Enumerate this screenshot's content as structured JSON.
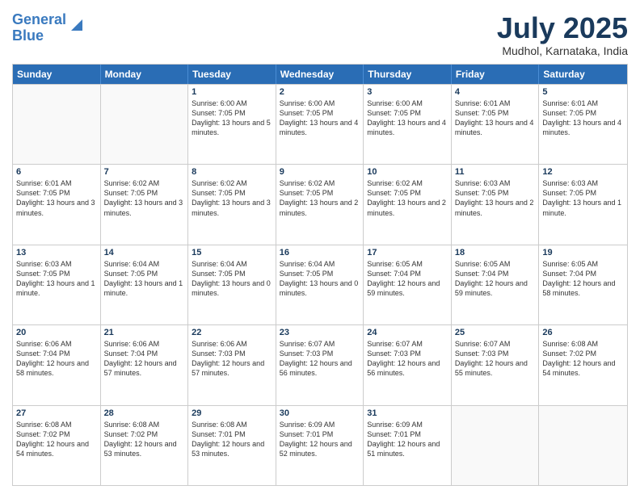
{
  "logo": {
    "line1": "General",
    "line2": "Blue"
  },
  "title": "July 2025",
  "location": "Mudhol, Karnataka, India",
  "days_of_week": [
    "Sunday",
    "Monday",
    "Tuesday",
    "Wednesday",
    "Thursday",
    "Friday",
    "Saturday"
  ],
  "weeks": [
    [
      {
        "day": "",
        "sunrise": "",
        "sunset": "",
        "daylight": "",
        "empty": true
      },
      {
        "day": "",
        "sunrise": "",
        "sunset": "",
        "daylight": "",
        "empty": true
      },
      {
        "day": "1",
        "sunrise": "Sunrise: 6:00 AM",
        "sunset": "Sunset: 7:05 PM",
        "daylight": "Daylight: 13 hours and 5 minutes."
      },
      {
        "day": "2",
        "sunrise": "Sunrise: 6:00 AM",
        "sunset": "Sunset: 7:05 PM",
        "daylight": "Daylight: 13 hours and 4 minutes."
      },
      {
        "day": "3",
        "sunrise": "Sunrise: 6:00 AM",
        "sunset": "Sunset: 7:05 PM",
        "daylight": "Daylight: 13 hours and 4 minutes."
      },
      {
        "day": "4",
        "sunrise": "Sunrise: 6:01 AM",
        "sunset": "Sunset: 7:05 PM",
        "daylight": "Daylight: 13 hours and 4 minutes."
      },
      {
        "day": "5",
        "sunrise": "Sunrise: 6:01 AM",
        "sunset": "Sunset: 7:05 PM",
        "daylight": "Daylight: 13 hours and 4 minutes."
      }
    ],
    [
      {
        "day": "6",
        "sunrise": "Sunrise: 6:01 AM",
        "sunset": "Sunset: 7:05 PM",
        "daylight": "Daylight: 13 hours and 3 minutes."
      },
      {
        "day": "7",
        "sunrise": "Sunrise: 6:02 AM",
        "sunset": "Sunset: 7:05 PM",
        "daylight": "Daylight: 13 hours and 3 minutes."
      },
      {
        "day": "8",
        "sunrise": "Sunrise: 6:02 AM",
        "sunset": "Sunset: 7:05 PM",
        "daylight": "Daylight: 13 hours and 3 minutes."
      },
      {
        "day": "9",
        "sunrise": "Sunrise: 6:02 AM",
        "sunset": "Sunset: 7:05 PM",
        "daylight": "Daylight: 13 hours and 2 minutes."
      },
      {
        "day": "10",
        "sunrise": "Sunrise: 6:02 AM",
        "sunset": "Sunset: 7:05 PM",
        "daylight": "Daylight: 13 hours and 2 minutes."
      },
      {
        "day": "11",
        "sunrise": "Sunrise: 6:03 AM",
        "sunset": "Sunset: 7:05 PM",
        "daylight": "Daylight: 13 hours and 2 minutes."
      },
      {
        "day": "12",
        "sunrise": "Sunrise: 6:03 AM",
        "sunset": "Sunset: 7:05 PM",
        "daylight": "Daylight: 13 hours and 1 minute."
      }
    ],
    [
      {
        "day": "13",
        "sunrise": "Sunrise: 6:03 AM",
        "sunset": "Sunset: 7:05 PM",
        "daylight": "Daylight: 13 hours and 1 minute."
      },
      {
        "day": "14",
        "sunrise": "Sunrise: 6:04 AM",
        "sunset": "Sunset: 7:05 PM",
        "daylight": "Daylight: 13 hours and 1 minute."
      },
      {
        "day": "15",
        "sunrise": "Sunrise: 6:04 AM",
        "sunset": "Sunset: 7:05 PM",
        "daylight": "Daylight: 13 hours and 0 minutes."
      },
      {
        "day": "16",
        "sunrise": "Sunrise: 6:04 AM",
        "sunset": "Sunset: 7:05 PM",
        "daylight": "Daylight: 13 hours and 0 minutes."
      },
      {
        "day": "17",
        "sunrise": "Sunrise: 6:05 AM",
        "sunset": "Sunset: 7:04 PM",
        "daylight": "Daylight: 12 hours and 59 minutes."
      },
      {
        "day": "18",
        "sunrise": "Sunrise: 6:05 AM",
        "sunset": "Sunset: 7:04 PM",
        "daylight": "Daylight: 12 hours and 59 minutes."
      },
      {
        "day": "19",
        "sunrise": "Sunrise: 6:05 AM",
        "sunset": "Sunset: 7:04 PM",
        "daylight": "Daylight: 12 hours and 58 minutes."
      }
    ],
    [
      {
        "day": "20",
        "sunrise": "Sunrise: 6:06 AM",
        "sunset": "Sunset: 7:04 PM",
        "daylight": "Daylight: 12 hours and 58 minutes."
      },
      {
        "day": "21",
        "sunrise": "Sunrise: 6:06 AM",
        "sunset": "Sunset: 7:04 PM",
        "daylight": "Daylight: 12 hours and 57 minutes."
      },
      {
        "day": "22",
        "sunrise": "Sunrise: 6:06 AM",
        "sunset": "Sunset: 7:03 PM",
        "daylight": "Daylight: 12 hours and 57 minutes."
      },
      {
        "day": "23",
        "sunrise": "Sunrise: 6:07 AM",
        "sunset": "Sunset: 7:03 PM",
        "daylight": "Daylight: 12 hours and 56 minutes."
      },
      {
        "day": "24",
        "sunrise": "Sunrise: 6:07 AM",
        "sunset": "Sunset: 7:03 PM",
        "daylight": "Daylight: 12 hours and 56 minutes."
      },
      {
        "day": "25",
        "sunrise": "Sunrise: 6:07 AM",
        "sunset": "Sunset: 7:03 PM",
        "daylight": "Daylight: 12 hours and 55 minutes."
      },
      {
        "day": "26",
        "sunrise": "Sunrise: 6:08 AM",
        "sunset": "Sunset: 7:02 PM",
        "daylight": "Daylight: 12 hours and 54 minutes."
      }
    ],
    [
      {
        "day": "27",
        "sunrise": "Sunrise: 6:08 AM",
        "sunset": "Sunset: 7:02 PM",
        "daylight": "Daylight: 12 hours and 54 minutes."
      },
      {
        "day": "28",
        "sunrise": "Sunrise: 6:08 AM",
        "sunset": "Sunset: 7:02 PM",
        "daylight": "Daylight: 12 hours and 53 minutes."
      },
      {
        "day": "29",
        "sunrise": "Sunrise: 6:08 AM",
        "sunset": "Sunset: 7:01 PM",
        "daylight": "Daylight: 12 hours and 53 minutes."
      },
      {
        "day": "30",
        "sunrise": "Sunrise: 6:09 AM",
        "sunset": "Sunset: 7:01 PM",
        "daylight": "Daylight: 12 hours and 52 minutes."
      },
      {
        "day": "31",
        "sunrise": "Sunrise: 6:09 AM",
        "sunset": "Sunset: 7:01 PM",
        "daylight": "Daylight: 12 hours and 51 minutes."
      },
      {
        "day": "",
        "sunrise": "",
        "sunset": "",
        "daylight": "",
        "empty": true
      },
      {
        "day": "",
        "sunrise": "",
        "sunset": "",
        "daylight": "",
        "empty": true
      }
    ]
  ]
}
